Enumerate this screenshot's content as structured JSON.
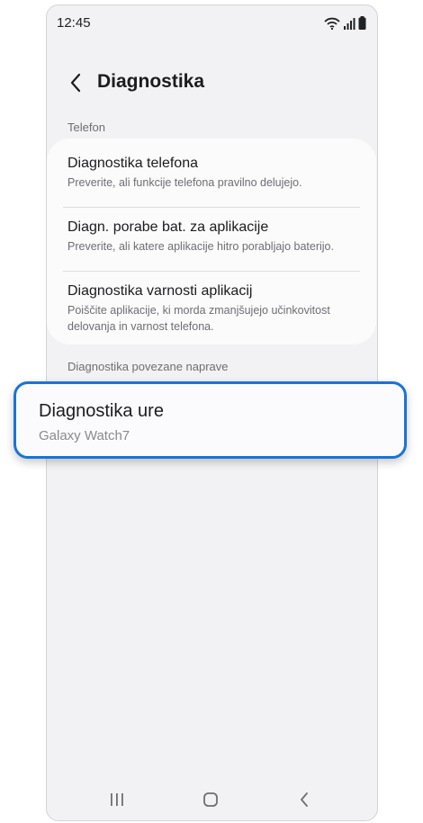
{
  "status_bar": {
    "time": "12:45",
    "icons": [
      "wifi-icon",
      "signal-icon",
      "battery-icon"
    ]
  },
  "header": {
    "title": "Diagnostika",
    "back_icon": "back-arrow-icon"
  },
  "section_phone": {
    "label": "Telefon",
    "items": [
      {
        "title": "Diagnostika telefona",
        "subtitle": "Preverite, ali funkcije telefona pravilno delujejo."
      },
      {
        "title": "Diagn. porabe bat. za aplikacije",
        "subtitle": "Preverite, ali katere aplikacije hitro porabljajo baterijo."
      },
      {
        "title": "Diagnostika varnosti aplikacij",
        "subtitle_line1": "Poiščite aplikacije, ki morda zmanjšujejo učinkovitost",
        "subtitle_line2": "delovanja in varnost telefona."
      }
    ]
  },
  "section_device": {
    "label": "Diagnostika povezane naprave",
    "item": {
      "title": "Diagnostika ure",
      "subtitle": "Galaxy Watch7"
    }
  },
  "colors": {
    "accent": "#1a73d8",
    "background": "#f2f2f4",
    "card": "#fbfbfc"
  },
  "nav_bar": {
    "icons": [
      "recents-icon",
      "home-icon",
      "back-icon"
    ]
  }
}
